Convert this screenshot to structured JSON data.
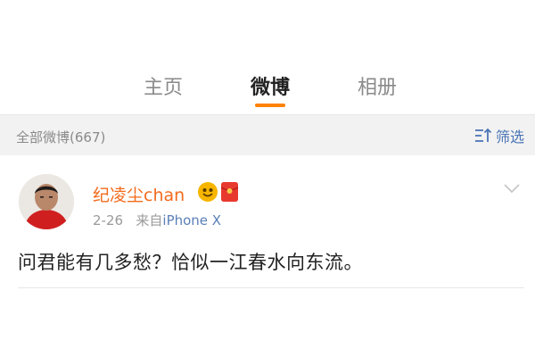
{
  "tabs": [
    {
      "label": "主页"
    },
    {
      "label": "微博"
    },
    {
      "label": "相册"
    }
  ],
  "filter_bar": {
    "count_label": "全部微博(667)",
    "filter_label": "筛选"
  },
  "post": {
    "username": "纪凌尘chan",
    "date": "2-26",
    "source_prefix": "来自",
    "source": "iPhone X",
    "text": "问君能有几多愁？恰似一江春水向东流。"
  },
  "colors": {
    "accent": "#ff8200",
    "username": "#f26b1d",
    "link": "#4a74b5"
  }
}
